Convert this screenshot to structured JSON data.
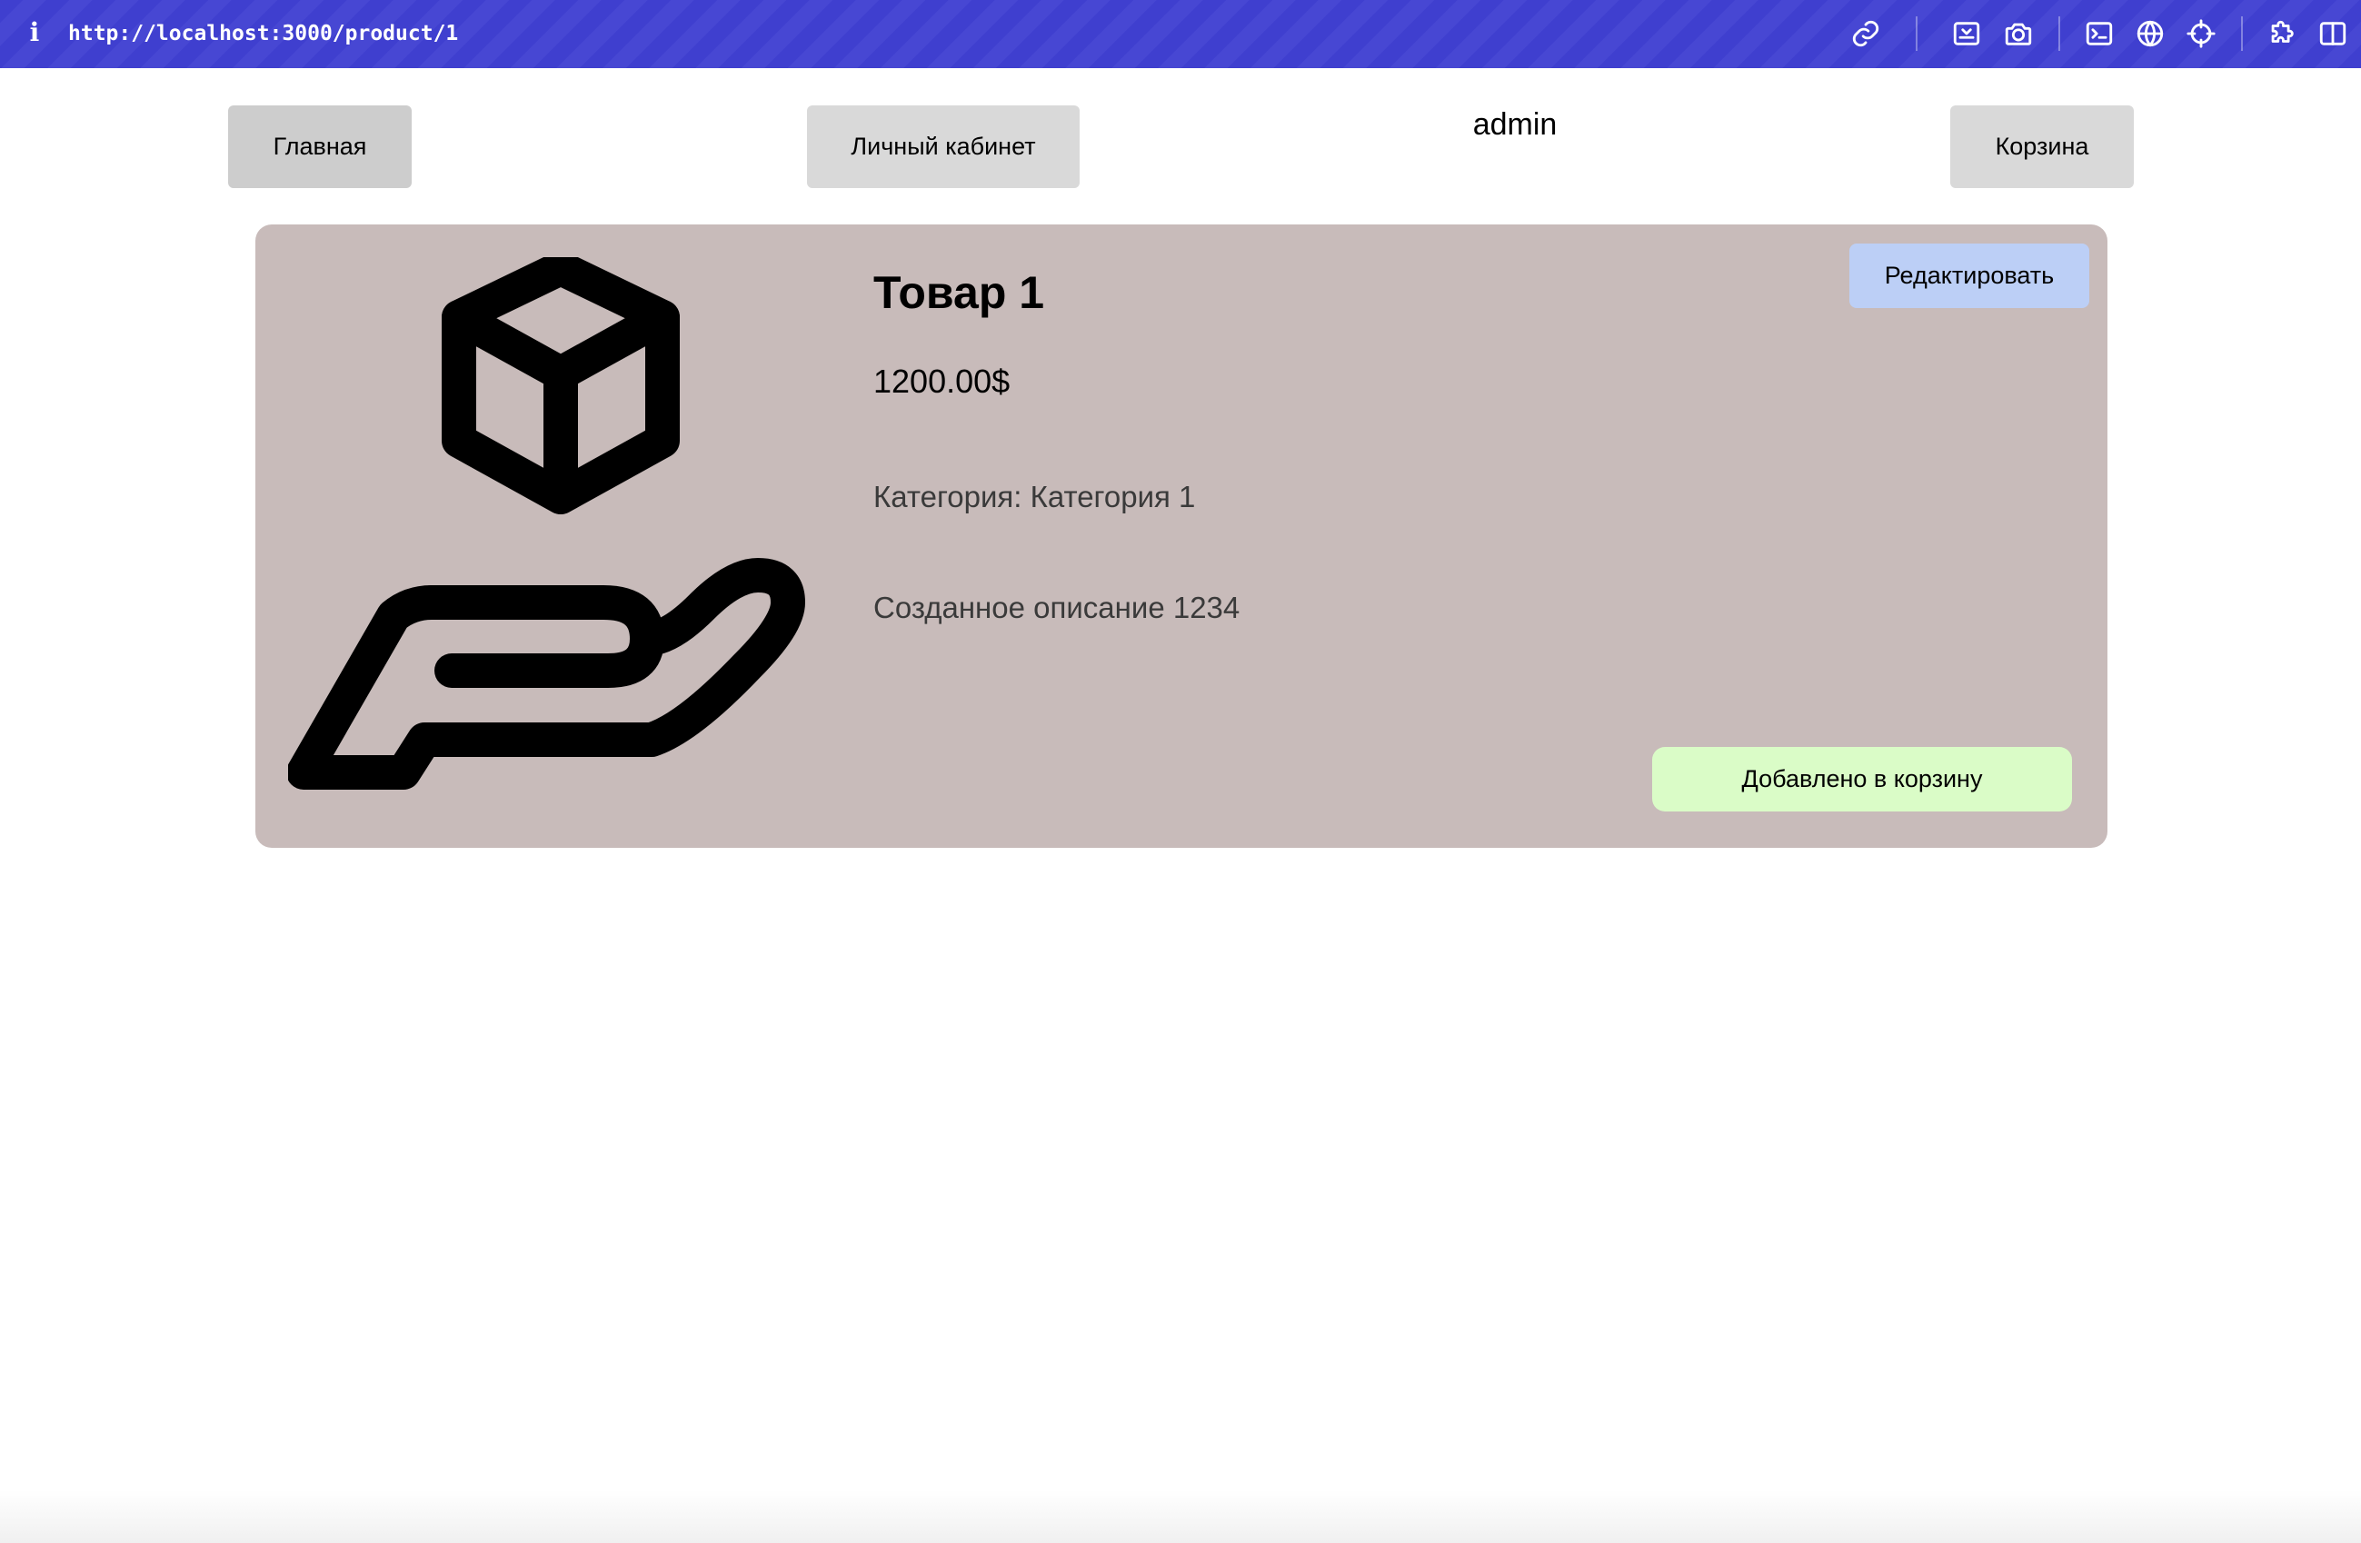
{
  "browser": {
    "url": "http://localhost:3000/product/1",
    "info_icon": "i",
    "toolbar_icons": [
      "link-icon",
      "screenshot-area-icon",
      "camera-icon",
      "terminal-icon",
      "globe-icon",
      "crosshair-icon",
      "extension-icon",
      "sidebar-icon"
    ],
    "accent_color": "#3f3fcf"
  },
  "nav": {
    "home_label": "Главная",
    "cabinet_label": "Личный кабинет",
    "username": "admin",
    "cart_label": "Корзина"
  },
  "product": {
    "image_icon": "hand-holding-box-icon",
    "title": "Товар 1",
    "price": "1200.00$",
    "category": "Категория: Категория 1",
    "description": "Созданное описание 1234",
    "edit_label": "Редактировать",
    "cart_status_label": "Добавлено в корзину",
    "card_color": "#c8bbba",
    "edit_color": "#bccff6",
    "cart_color": "#dafcc7"
  }
}
